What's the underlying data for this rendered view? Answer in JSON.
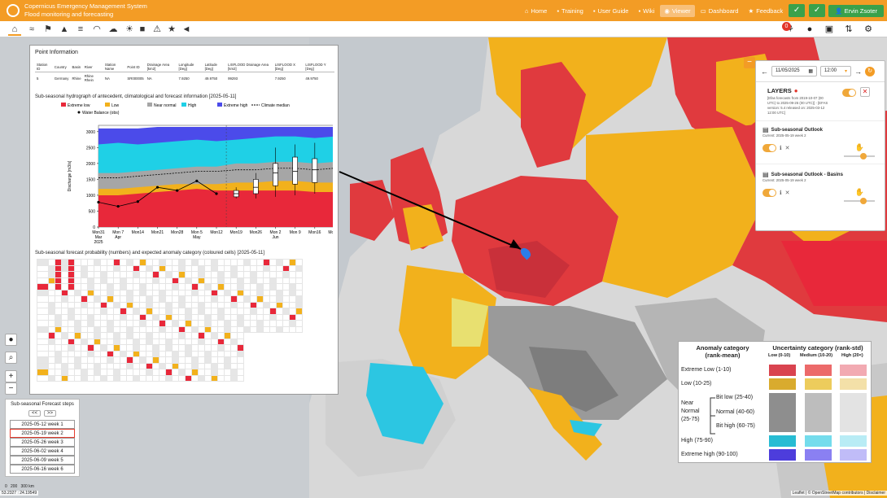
{
  "header": {
    "app_title": "Copernicus Emergency Management System",
    "app_subtitle": "Flood monitoring and forecasting",
    "nav": [
      "Home",
      "Training",
      "User Guide",
      "Wiki",
      "Viewer",
      "Dashboard",
      "Feedback"
    ],
    "active_nav": "Viewer",
    "user": "Ervin Zsoter"
  },
  "toolbar": {
    "notification_count": "0"
  },
  "point_info": {
    "title": "Point Information",
    "columns": [
      "Station ID",
      "Country",
      "Basin",
      "River",
      "Station Name",
      "Point ID",
      "Drainage Area [km2]",
      "Longitude [Deg]",
      "Latitude [Deg]",
      "LISFLOOD Drainage Area [km2]",
      "LISFLOOD X [Deg]",
      "LISFLOOD Y [Deg]"
    ],
    "row": [
      "5",
      "Germany",
      "Rhine",
      "Rhine Rhein",
      "NA",
      "SR000005",
      "NA",
      "7.9250",
      "49.9750",
      "99293",
      "7.9250",
      "49.9750"
    ],
    "hydrograph_title": "Sub-seasonal hydrograph of antecedent, climatological and forecast information [2025-05-11]",
    "table_title": "Sub-seasonal forecast probability (numbers) and expected anomaly category (coloured cells) [2025-05-11]"
  },
  "chart_data": {
    "type": "area",
    "title": "",
    "ylabel": "Discharge [m3/s]",
    "ylim": [
      0,
      3200
    ],
    "yticks": [
      0,
      500,
      1000,
      1500,
      2000,
      2500,
      3000
    ],
    "categories": [
      "Mon31 Mar 2025",
      "Mon 7 Apr",
      "Mon14",
      "Mon21",
      "Mon28",
      "Mon 5 May",
      "Mon12",
      "Mon19",
      "Mon26",
      "Mon 2 Jun",
      "Mon 9",
      "Mon16",
      "Mon23"
    ],
    "legend": [
      "Extreme low",
      "Low",
      "Near normal",
      "High",
      "Extreme high",
      "Climate median",
      "Water Balance (obs)"
    ],
    "colors": {
      "extreme_low": "#e8283a",
      "low": "#f2b11c",
      "near_normal": "#a6a6a6",
      "high": "#1fd0e6",
      "extreme_high": "#4b4bea"
    },
    "band_upper": {
      "extreme_low": [
        1000,
        1000,
        1050,
        1100,
        1150,
        1200,
        1150,
        1150,
        1150,
        1150,
        1150,
        1100,
        1100
      ],
      "low": [
        1200,
        1200,
        1250,
        1300,
        1350,
        1350,
        1350,
        1400,
        1400,
        1450,
        1450,
        1400,
        1400
      ],
      "near_normal": [
        1700,
        1700,
        1750,
        1800,
        1850,
        1900,
        1900,
        2000,
        2000,
        2050,
        2050,
        2000,
        2050
      ],
      "high": [
        2600,
        2650,
        2600,
        2650,
        2700,
        2750,
        2700,
        2750,
        2800,
        2850,
        2850,
        2800,
        2850
      ],
      "extreme_high": [
        3100,
        3100,
        3100,
        3150,
        3150,
        3150,
        3150,
        3150,
        3150,
        3150,
        3150,
        3150,
        3150
      ]
    },
    "climate_median": [
      1550,
      1550,
      1600,
      1650,
      1700,
      1750,
      1750,
      1800,
      1800,
      1850,
      1850,
      1800,
      1850
    ],
    "water_balance_obs": {
      "x_index": [
        0,
        1,
        2,
        3,
        4,
        5,
        6
      ],
      "values": [
        780,
        650,
        800,
        1250,
        1150,
        1450,
        1050
      ]
    },
    "boxes": [
      {
        "x_index": 7,
        "min": 900,
        "q1": 950,
        "median": 1050,
        "q3": 1150,
        "max": 1250
      },
      {
        "x_index": 8,
        "min": 900,
        "q1": 1050,
        "median": 1250,
        "q3": 1500,
        "max": 1700
      },
      {
        "x_index": 9,
        "min": 950,
        "q1": 1300,
        "median": 1700,
        "q3": 2000,
        "max": 2500
      },
      {
        "x_index": 10,
        "min": 1000,
        "q1": 1350,
        "median": 1750,
        "q3": 2200,
        "max": 2600
      },
      {
        "x_index": 11,
        "min": 1050,
        "q1": 1400,
        "median": 1800,
        "q3": 2150,
        "max": 2650
      }
    ]
  },
  "layers_panel": {
    "date": "11/05/2025",
    "time": "12:00",
    "title": "LAYERS",
    "description": "[Efas forecasts from 2019-10-07 (00 UTC) to 2025-09-26 (00 UTC)] - [EFAS version: 5.4 released on: 2025-03-12 12:00 UTC]",
    "layer1_name": "Sub-seasonal Outlook",
    "layer1_current": "Current: 2025-05-19 week 2",
    "layer2_name": "Sub-seasonal Outlook - Basins",
    "layer2_current": "Current: 2025-05-19 week 2"
  },
  "legend": {
    "anomaly_header": "Anomaly category (rank-mean)",
    "uncertainty_header": "Uncertainty category (rank-std)",
    "uncertainty_cols": [
      "Low (0-10)",
      "Medium (10-20)",
      "High (20<)"
    ],
    "rows": [
      "Extreme Low (1-10)",
      "Low (10-25)",
      "Near Normal (25-75)",
      "Bit low (25-40)",
      "Normal (40-60)",
      "Bit high (60-75)",
      "High (75-90)",
      "Extreme high (90-100)"
    ]
  },
  "steps": {
    "title": "Sub-seasonal Forecast steps",
    "prev": "<<",
    "next": ">>",
    "items": [
      "2025-05-12 week 1",
      "2025-05-19 week 2",
      "2025-05-26 week 3",
      "2025-06-02 week 4",
      "2025-06-09 week 5",
      "2025-06-16 week 6"
    ],
    "selected_index": 1
  },
  "map": {
    "coords": "53.2327 : 24.19549",
    "scale_labels": [
      "0",
      "200",
      "300 km"
    ],
    "attribution": "Leaflet | © OpenStreetMap contributors | Disclaimer"
  }
}
